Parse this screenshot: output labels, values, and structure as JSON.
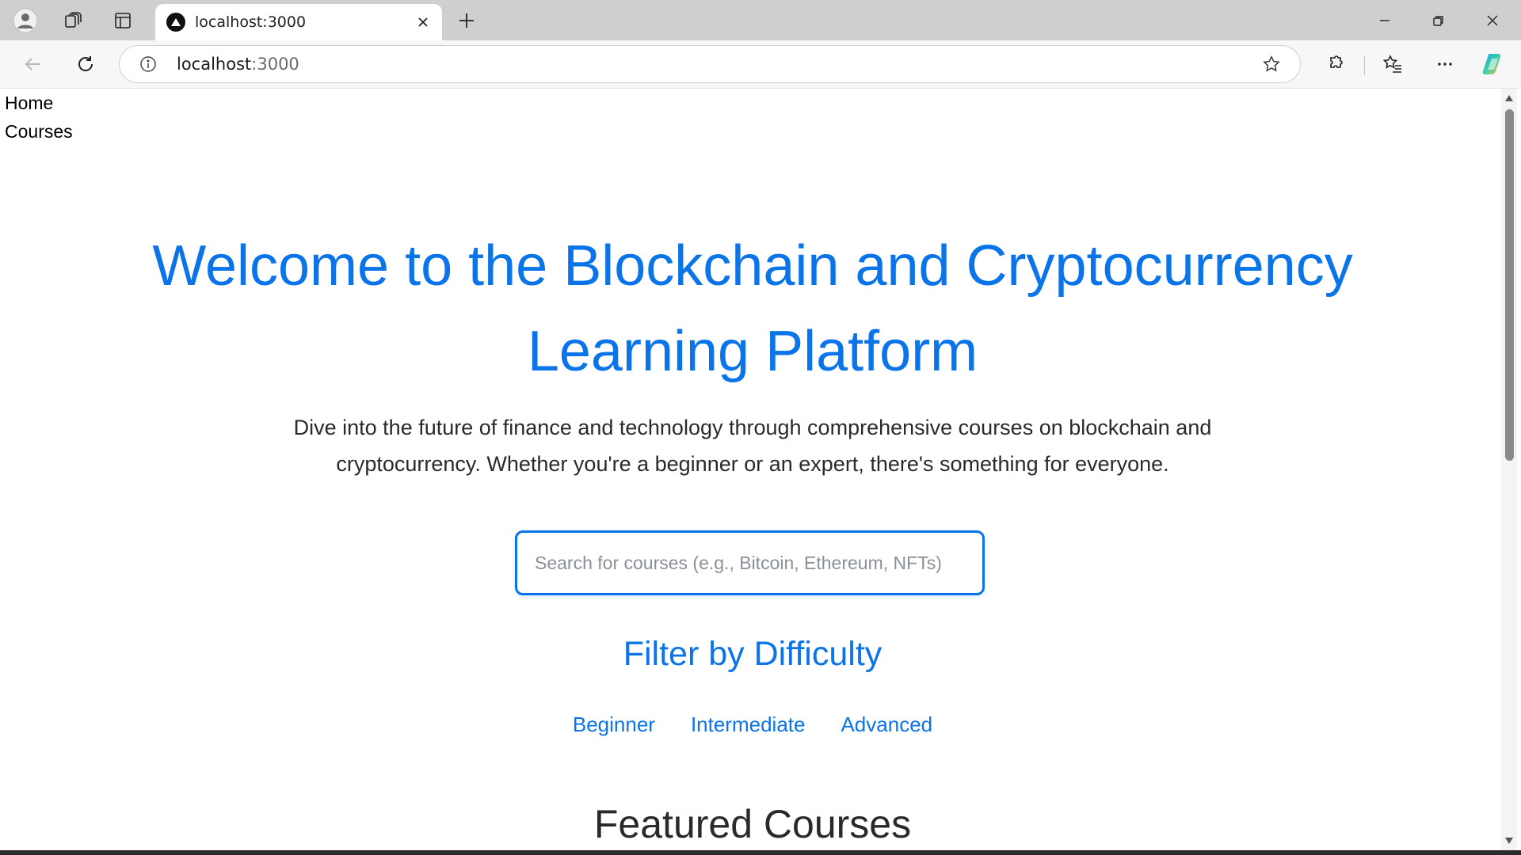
{
  "browser": {
    "tab_title": "localhost:3000",
    "url_host": "localhost",
    "url_port": ":3000"
  },
  "page": {
    "nav": [
      "Home",
      "Courses"
    ],
    "hero": {
      "title_line1": "Welcome to the Blockchain and Cryptocurrency",
      "title_line2": "Learning Platform",
      "description": "Dive into the future of finance and technology through comprehensive courses on blockchain and cryptocurrency. Whether you're a beginner or an expert, there's something for everyone."
    },
    "search": {
      "placeholder": "Search for courses (e.g., Bitcoin, Ethereum, NFTs)",
      "value": ""
    },
    "filter": {
      "title": "Filter by Difficulty",
      "options": [
        "Beginner",
        "Intermediate",
        "Advanced"
      ]
    },
    "featured_title": "Featured Courses"
  },
  "colors": {
    "accent": "#0a74e8",
    "text": "#2a2a2a"
  }
}
